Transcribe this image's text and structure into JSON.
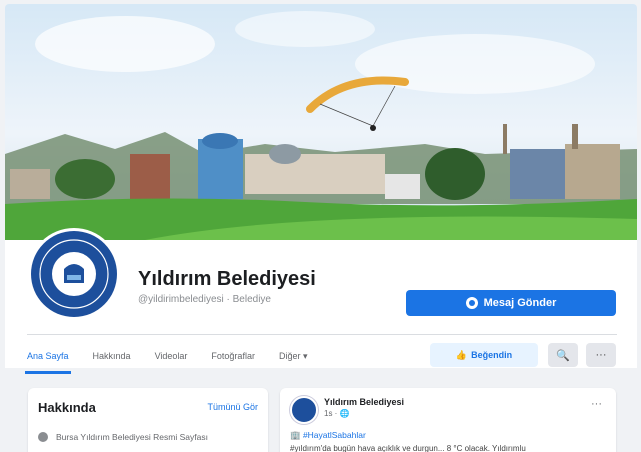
{
  "page": {
    "name": "Yıldırım Belediyesi",
    "handle": "@yildirimbelediyesi · Belediye"
  },
  "actions": {
    "message_label": "Mesaj Gönder",
    "like_label": "Beğendin",
    "search_icon": "search-icon",
    "more_icon": "more-icon"
  },
  "tabs": [
    {
      "label": "Ana Sayfa",
      "active": true
    },
    {
      "label": "Hakkında",
      "active": false
    },
    {
      "label": "Videolar",
      "active": false
    },
    {
      "label": "Fotoğraflar",
      "active": false
    },
    {
      "label": "Diğer ▾",
      "active": false
    }
  ],
  "about": {
    "title": "Hakkında",
    "see_all": "Tümünü Gör",
    "description": "Bursa Yıldırım Belediyesi Resmi Sayfası"
  },
  "post": {
    "author": "Yıldırım Belediyesi",
    "time": "1s · 🌐",
    "hashtag": "🏢 #HayatlSabahlar",
    "text": "#yıldırım'da bugün hava açıklık ve durgun... 8 °C olacak. Yıldırımlu",
    "more": "···"
  },
  "colors": {
    "accent": "#1b74e4",
    "brand_blue": "#1d4f9c"
  }
}
